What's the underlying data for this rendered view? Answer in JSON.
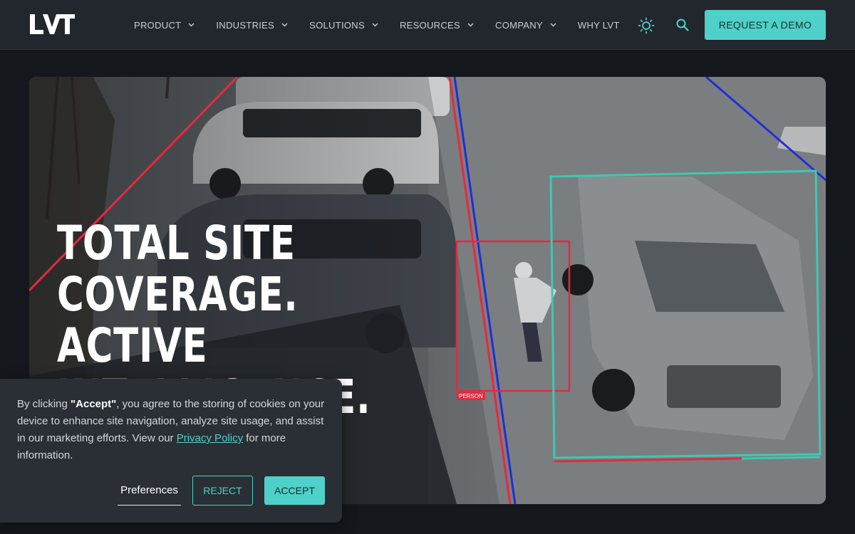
{
  "nav": {
    "logo": "LVT",
    "items": [
      {
        "label": "PRODUCT",
        "has_dropdown": true
      },
      {
        "label": "INDUSTRIES",
        "has_dropdown": true
      },
      {
        "label": "SOLUTIONS",
        "has_dropdown": true
      },
      {
        "label": "RESOURCES",
        "has_dropdown": true
      },
      {
        "label": "COMPANY",
        "has_dropdown": true
      },
      {
        "label": "WHY LVT",
        "has_dropdown": false
      }
    ],
    "theme_icon": "sun-icon",
    "search_icon": "search-icon",
    "cta_label": "REQUEST A DEMO"
  },
  "hero": {
    "headline": "TOTAL SITE\nCOVERAGE. ACTIVE\nINTELLIGENCE.\nPROBLEMS SOLVED.",
    "detection_label": "PERSON"
  },
  "cookie": {
    "text_before": "By clicking ",
    "accept_quote": "\"Accept\"",
    "text_middle": ", you agree to the storing of cookies on your device to enhance site navigation, analyze site usage, and assist in our marketing efforts. View our ",
    "privacy_link": "Privacy Policy",
    "text_after": " for more information.",
    "preferences_label": "Preferences",
    "reject_label": "REJECT",
    "accept_label": "ACCEPT"
  },
  "colors": {
    "accent": "#4fd0c9",
    "nav_bg": "#22272d",
    "page_bg": "#14181d",
    "zone_red": "#e8283f",
    "zone_blue": "#1f2fd6",
    "zone_teal": "#3ec9b0"
  }
}
